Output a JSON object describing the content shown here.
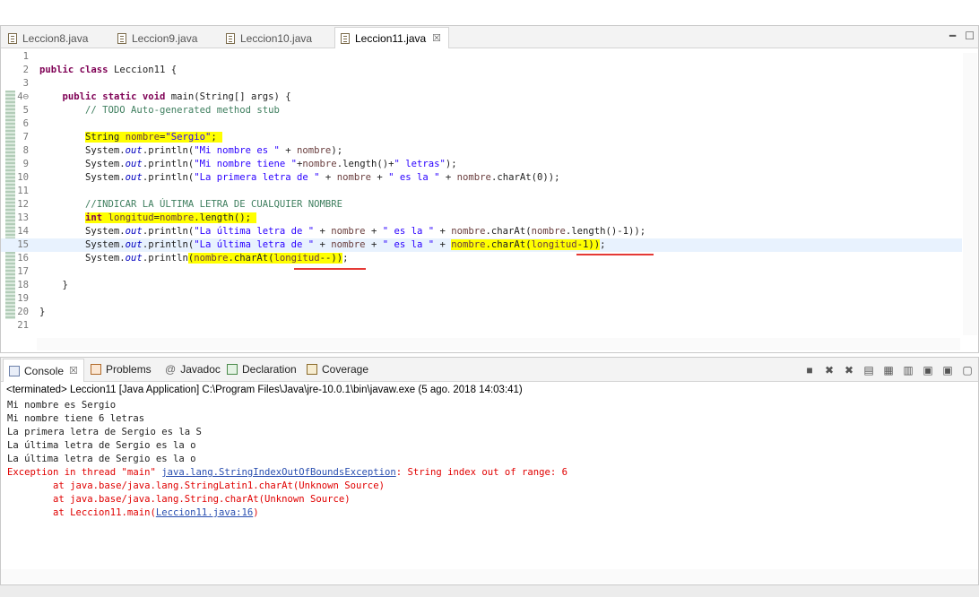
{
  "editor": {
    "tabs": [
      {
        "label": "Leccion8.java",
        "active": false
      },
      {
        "label": "Leccion9.java",
        "active": false
      },
      {
        "label": "Leccion10.java",
        "active": false
      },
      {
        "label": "Leccion11.java",
        "active": true
      }
    ],
    "close_glyph": "☒",
    "window_controls": {
      "minimize": "━",
      "maximize": "☐"
    },
    "lines": [
      {
        "n": "1",
        "code": ""
      },
      {
        "n": "2",
        "code": "public class Leccion11 {"
      },
      {
        "n": "3",
        "code": ""
      },
      {
        "n": "4⊖",
        "code": "    public static void main(String[] args) {"
      },
      {
        "n": "5",
        "code": "        // TODO Auto-generated method stub"
      },
      {
        "n": "6",
        "code": ""
      },
      {
        "n": "7",
        "code": "        String nombre=\"Sergio\";"
      },
      {
        "n": "8",
        "code": "        System.out.println(\"Mi nombre es \" + nombre);"
      },
      {
        "n": "9",
        "code": "        System.out.println(\"Mi nombre tiene \"+nombre.length()+\" letras\");"
      },
      {
        "n": "10",
        "code": "        System.out.println(\"La primera letra de \" + nombre + \" es la \" + nombre.charAt(0));"
      },
      {
        "n": "11",
        "code": ""
      },
      {
        "n": "12",
        "code": "        //INDICAR LA ÚLTIMA LETRA DE CUALQUIER NOMBRE"
      },
      {
        "n": "13",
        "code": "        int longitud=nombre.length();"
      },
      {
        "n": "14",
        "code": "        System.out.println(\"La última letra de \" + nombre + \" es la \" + nombre.charAt(nombre.length()-1));"
      },
      {
        "n": "15",
        "code": "        System.out.println(\"La última letra de \" + nombre + \" es la \" + nombre.charAt(longitud-1));"
      },
      {
        "n": "16",
        "code": "        System.out.println(nombre.charAt(longitud--));"
      },
      {
        "n": "17",
        "code": ""
      },
      {
        "n": "18",
        "code": "    }"
      },
      {
        "n": "19",
        "code": ""
      },
      {
        "n": "20",
        "code": "}"
      },
      {
        "n": "21",
        "code": ""
      }
    ]
  },
  "console": {
    "tabs": [
      {
        "label": "Console",
        "icon": "console-icon",
        "active": true
      },
      {
        "label": "Problems",
        "icon": "problems-icon",
        "active": false
      },
      {
        "label": "Javadoc",
        "icon": "javadoc-icon",
        "active": false
      },
      {
        "label": "Declaration",
        "icon": "declaration-icon",
        "active": false
      },
      {
        "label": "Coverage",
        "icon": "coverage-icon",
        "active": false
      }
    ],
    "terminated_line": "<terminated> Leccion11 [Java Application] C:\\Program Files\\Java\\jre-10.0.1\\bin\\javaw.exe (5 ago. 2018 14:03:41)",
    "output": [
      "Mi nombre es Sergio",
      "Mi nombre tiene 6 letras",
      "La primera letra de Sergio es la S",
      "La última letra de Sergio es la o",
      "La última letra de Sergio es la o"
    ],
    "exception": {
      "prefix": "Exception in thread \"main\" ",
      "type": "java.lang.StringIndexOutOfBoundsException",
      "message": ": String index out of range: 6",
      "stack": [
        {
          "text": "        at java.base/java.lang.StringLatin1.charAt(Unknown Source)"
        },
        {
          "text": "        at java.base/java.lang.String.charAt(Unknown Source)"
        },
        {
          "prefix": "        at Leccion11.main(",
          "link": "Leccion11.java:16",
          "suffix": ")"
        }
      ]
    }
  },
  "colors": {
    "keyword": "#7f0055",
    "string": "#2a00ff",
    "comment": "#3f7f5f",
    "highlight": "#ffff00",
    "error": "#e00000",
    "link": "#2a4fb0"
  }
}
